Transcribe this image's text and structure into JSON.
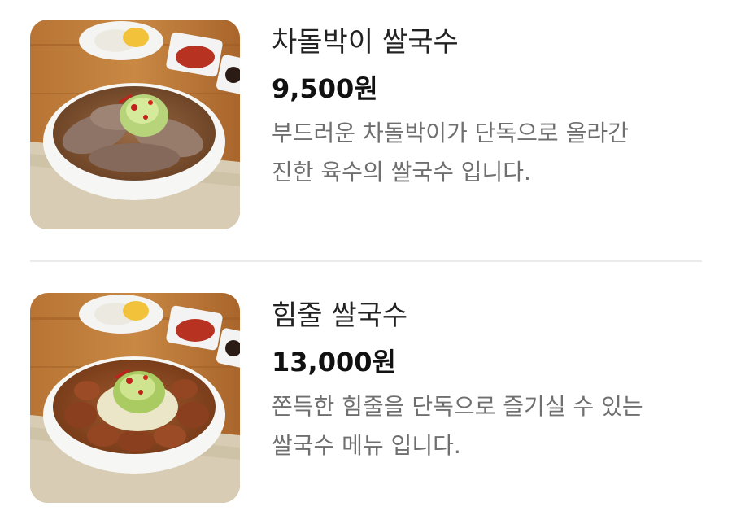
{
  "items": [
    {
      "name": "차돌박이 쌀국수",
      "price": "9,500원",
      "description_lines": [
        "부드러운 차돌박이가 단독으로 올라간",
        "진한 육수의 쌀국수 입니다."
      ],
      "image_icon": "brisket-pho-photo"
    },
    {
      "name": "힘줄 쌀국수",
      "price": "13,000원",
      "description_lines": [
        "쫀득한 힘줄을 단독으로 즐기실 수 있는",
        "쌀국수 메뉴 입니다."
      ],
      "image_icon": "tendon-pho-photo"
    }
  ],
  "colors": {
    "divider": "#ebebeb",
    "description_text": "#6f6f6f",
    "title_text": "#222222"
  }
}
